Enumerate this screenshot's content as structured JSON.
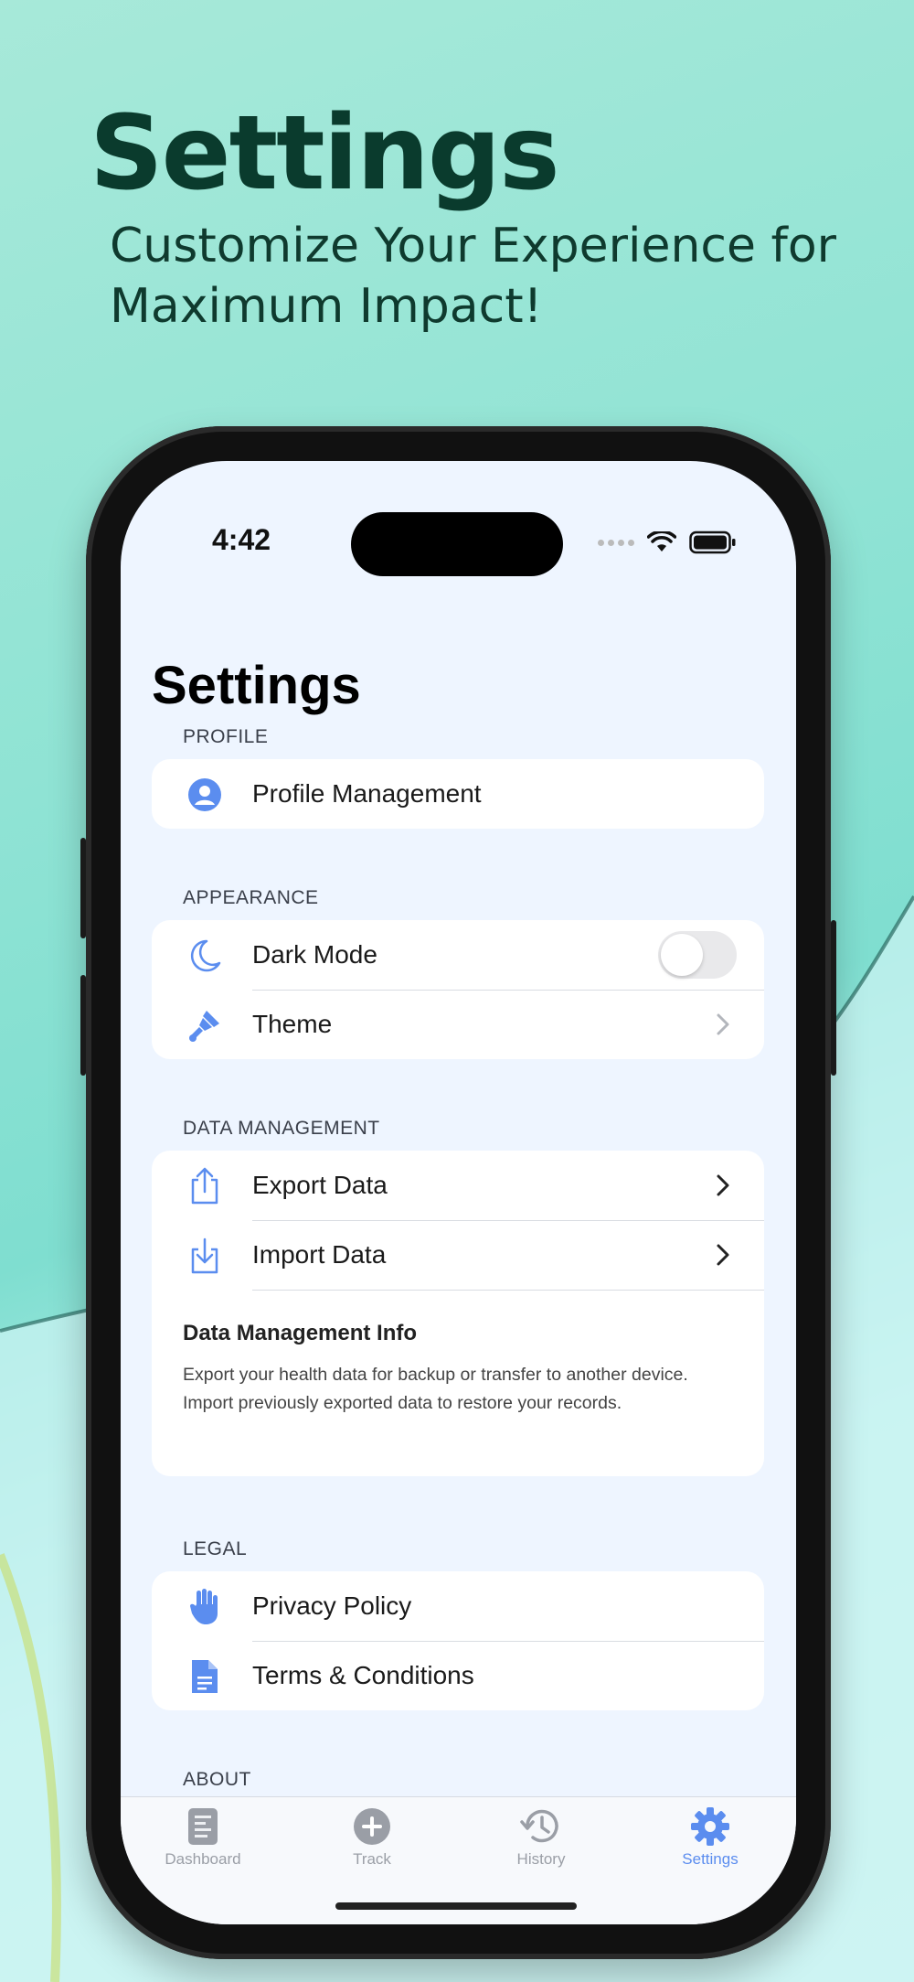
{
  "hero": {
    "title": "Settings",
    "subtitle": "Customize Your Experience for Maximum Impact!"
  },
  "status_bar": {
    "time": "4:42",
    "icons": [
      "signal-dots-icon",
      "wifi-icon",
      "battery-icon"
    ]
  },
  "page": {
    "title": "Settings"
  },
  "sections": {
    "profile": {
      "header": "PROFILE",
      "items": [
        {
          "label": "Profile Management",
          "icon": "person-circle-icon"
        }
      ]
    },
    "appearance": {
      "header": "APPEARANCE",
      "items": [
        {
          "label": "Dark Mode",
          "icon": "moon-icon",
          "toggle_on": false
        },
        {
          "label": "Theme",
          "icon": "paintbrush-icon"
        }
      ]
    },
    "data_management": {
      "header": "DATA MANAGEMENT",
      "items": [
        {
          "label": "Export Data",
          "icon": "share-upload-icon"
        },
        {
          "label": "Import Data",
          "icon": "download-tray-icon"
        }
      ],
      "info_title": "Data Management Info",
      "info_text": "Export your health data for backup or transfer to another device. Import previously exported data to restore your records."
    },
    "legal": {
      "header": "LEGAL",
      "items": [
        {
          "label": "Privacy Policy",
          "icon": "hand-raised-icon"
        },
        {
          "label": "Terms & Conditions",
          "icon": "document-icon"
        }
      ]
    },
    "about": {
      "header": "ABOUT"
    }
  },
  "tab_bar": {
    "tabs": [
      {
        "label": "Dashboard",
        "icon": "dashboard-doc-icon",
        "active": false
      },
      {
        "label": "Track",
        "icon": "plus-circle-icon",
        "active": false
      },
      {
        "label": "History",
        "icon": "clock-history-icon",
        "active": false
      },
      {
        "label": "Settings",
        "icon": "gear-icon",
        "active": true
      }
    ]
  },
  "colors": {
    "accent": "#5b8def",
    "background": "#eef5ff",
    "hero_text": "#0a3b2d"
  }
}
